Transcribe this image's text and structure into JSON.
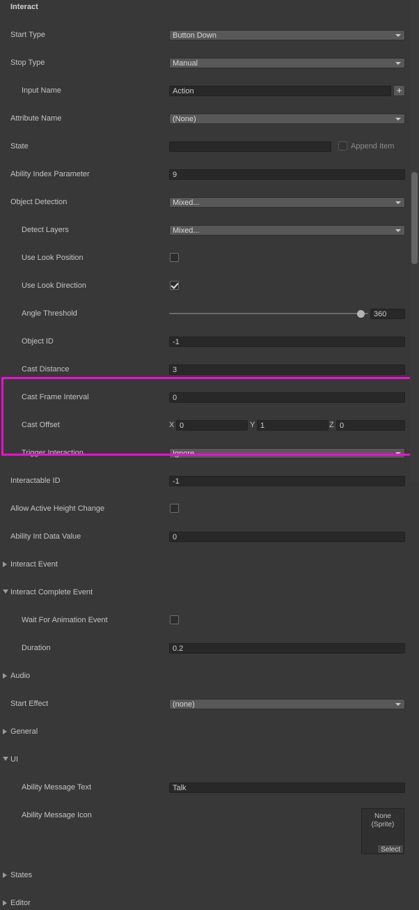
{
  "panel": {
    "title": "Interact",
    "accent_color": "#f20dd4",
    "background_color": "#383838"
  },
  "rows": [
    {
      "label": "Start Type",
      "indent": 0,
      "type": "popup",
      "value": "Button Down"
    },
    {
      "label": "Stop Type",
      "indent": 0,
      "type": "popup",
      "value": "Manual"
    },
    {
      "label": "Input Name",
      "indent": 1,
      "type": "text_plus",
      "value": "Action",
      "plus": "+"
    },
    {
      "label": "Attribute Name",
      "indent": 0,
      "type": "popup",
      "value": "(None)"
    },
    {
      "label": "State",
      "indent": 0,
      "type": "state",
      "value": "",
      "append_label": "Append Item",
      "append_checked": false
    },
    {
      "label": "Ability Index Parameter",
      "indent": 0,
      "type": "text",
      "value": "9"
    },
    {
      "label": "Object Detection",
      "indent": 0,
      "type": "popup",
      "value": "Mixed..."
    },
    {
      "label": "Detect Layers",
      "indent": 1,
      "type": "popup",
      "value": "Mixed..."
    },
    {
      "label": "Use Look Position",
      "indent": 1,
      "type": "checkbox",
      "checked": false
    },
    {
      "label": "Use Look Direction",
      "indent": 1,
      "type": "checkbox",
      "checked": true
    },
    {
      "label": "Angle Threshold",
      "indent": 1,
      "type": "slider",
      "value": "360",
      "fill_percent": 98
    },
    {
      "label": "Object ID",
      "indent": 1,
      "type": "text",
      "value": "-1"
    },
    {
      "label": "Cast Distance",
      "indent": 1,
      "type": "text",
      "value": "3"
    },
    {
      "label": "Cast Frame Interval",
      "indent": 1,
      "type": "text",
      "value": "0"
    },
    {
      "label": "Cast Offset",
      "indent": 1,
      "type": "vector3",
      "x_label": "X",
      "x": "0",
      "y_label": "Y",
      "y": "1",
      "z_label": "Z",
      "z": "0"
    },
    {
      "label": "Trigger Interaction",
      "indent": 1,
      "type": "popup",
      "value": "Ignore"
    },
    {
      "label": "Interactable ID",
      "indent": 0,
      "type": "text",
      "value": "-1"
    },
    {
      "label": "Allow Active Height Change",
      "indent": 0,
      "type": "checkbox",
      "checked": false
    },
    {
      "label": "Ability Int Data Value",
      "indent": 0,
      "type": "text",
      "value": "0"
    },
    {
      "label": "Interact Event",
      "indent": 0,
      "type": "foldout",
      "expanded": false
    },
    {
      "label": "Interact Complete Event",
      "indent": 0,
      "type": "foldout",
      "expanded": true
    },
    {
      "label": "Wait For Animation Event",
      "indent": 1,
      "type": "checkbox",
      "checked": false
    },
    {
      "label": "Duration",
      "indent": 1,
      "type": "text",
      "value": "0.2"
    },
    {
      "label": "Audio",
      "indent": 0,
      "type": "foldout",
      "expanded": false
    },
    {
      "label": "Start Effect",
      "indent": 0,
      "type": "popup",
      "value": "(none)"
    },
    {
      "label": "General",
      "indent": 0,
      "type": "foldout",
      "expanded": false
    },
    {
      "label": "UI",
      "indent": 0,
      "type": "foldout",
      "expanded": true
    },
    {
      "label": "Ability Message Text",
      "indent": 1,
      "type": "text",
      "value": "Talk"
    },
    {
      "label": "Ability Message Icon",
      "indent": 1,
      "type": "object",
      "object_line1": "None",
      "object_line2": "(Sprite)",
      "select_label": "Select"
    },
    {
      "label": "States",
      "indent": 0,
      "type": "foldout",
      "expanded": false
    },
    {
      "label": "Editor",
      "indent": 0,
      "type": "foldout",
      "expanded": false
    }
  ],
  "scrollbar": {
    "name": "vertical-scrollbar"
  }
}
